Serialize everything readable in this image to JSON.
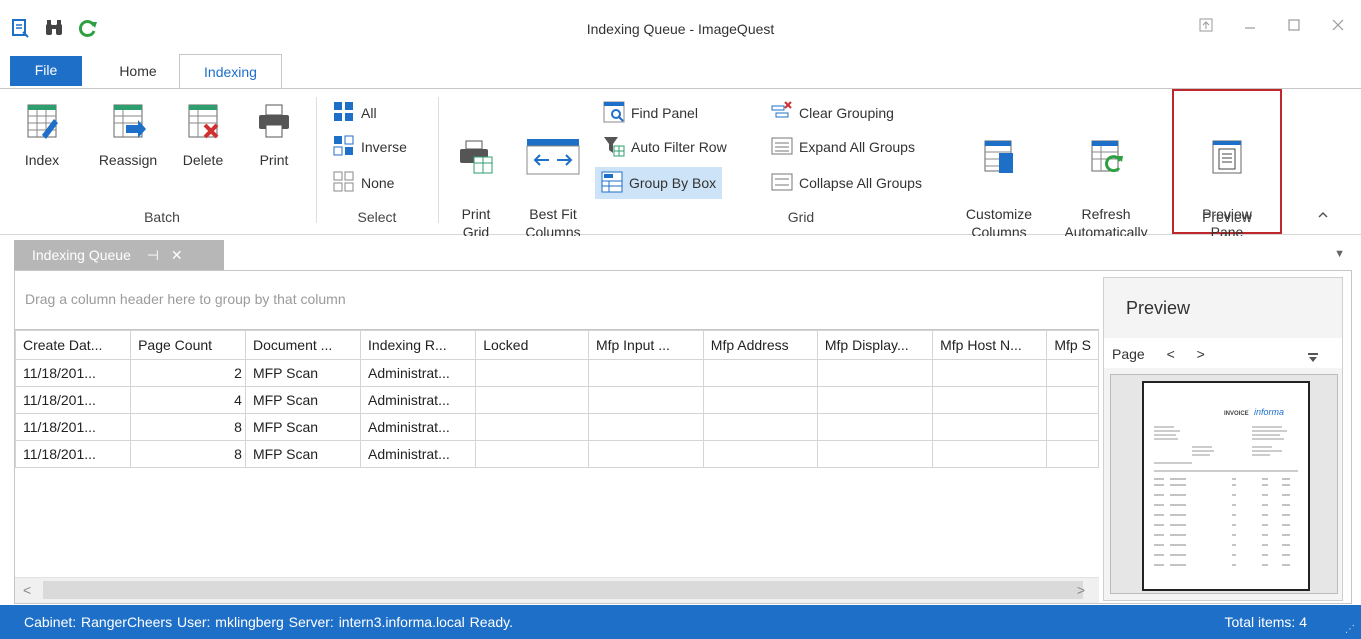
{
  "window": {
    "title": "Indexing Queue - ImageQuest",
    "qat_icons": [
      "preview-icon",
      "binoculars-icon",
      "refresh-icon"
    ],
    "controls": [
      "restore-icon",
      "minimize-icon",
      "maximize-icon",
      "close-icon"
    ],
    "accent": "#1e6fc8"
  },
  "ribbon_tabs": [
    {
      "label": "File"
    },
    {
      "label": "Home"
    },
    {
      "label": "Indexing",
      "active": true
    }
  ],
  "ribbon": {
    "batch": {
      "label": "Batch",
      "buttons": [
        {
          "label": "Index",
          "icon": "grid-edit-icon"
        },
        {
          "label": "Reassign",
          "icon": "grid-arrow-icon"
        },
        {
          "label": "Delete",
          "icon": "grid-delete-icon"
        },
        {
          "label": "Print",
          "icon": "printer-icon"
        }
      ]
    },
    "select": {
      "label": "Select",
      "items": [
        {
          "label": "All",
          "icon": "select-all-icon"
        },
        {
          "label": "Inverse",
          "icon": "select-inverse-icon"
        },
        {
          "label": "None",
          "icon": "select-none-icon"
        }
      ]
    },
    "grid": {
      "label": "Grid",
      "print_grid": "Print\nGrid",
      "best_fit": "Best Fit\nColumns",
      "find_panel": "Find Panel",
      "auto_filter": "Auto Filter Row",
      "group_by_box": "Group By Box",
      "clear_grouping": "Clear Grouping",
      "expand_all": "Expand All Groups",
      "collapse_all": "Collapse All Groups",
      "customize_columns": "Customize\nColumns",
      "refresh_auto": "Refresh\nAutomatically"
    },
    "preview": {
      "label": "Preview",
      "button": "Preview\nPane",
      "highlight_color": "#c0272d"
    }
  },
  "doc_tab": {
    "label": "Indexing Queue"
  },
  "group_panel_hint": "Drag a column header here to group by that column",
  "table": {
    "columns": [
      "Create Dat...",
      "Page Count",
      "Document ...",
      "Indexing R...",
      "Locked",
      "Mfp Input ...",
      "Mfp Address",
      "Mfp Display...",
      "Mfp Host N...",
      "Mfp S"
    ],
    "rows": [
      [
        "11/18/201...",
        "2",
        "MFP Scan",
        "Administrat...",
        "",
        "",
        "",
        "",
        "",
        ""
      ],
      [
        "11/18/201...",
        "4",
        "MFP Scan",
        "Administrat...",
        "",
        "",
        "",
        "",
        "",
        ""
      ],
      [
        "11/18/201...",
        "8",
        "MFP Scan",
        "Administrat...",
        "",
        "",
        "",
        "",
        "",
        ""
      ],
      [
        "11/18/201...",
        "8",
        "MFP Scan",
        "Administrat...",
        "",
        "",
        "",
        "",
        "",
        ""
      ]
    ]
  },
  "preview_pane": {
    "title": "Preview",
    "page_label": "Page",
    "prev": "<",
    "next": ">",
    "doc_brand": "informa",
    "doc_heading": "INVOICE"
  },
  "status": {
    "left": "Cabinet: RangerCheers   User: mklingberg   Server: intern3.informa.local   Ready.",
    "right": "Total items: 4"
  }
}
